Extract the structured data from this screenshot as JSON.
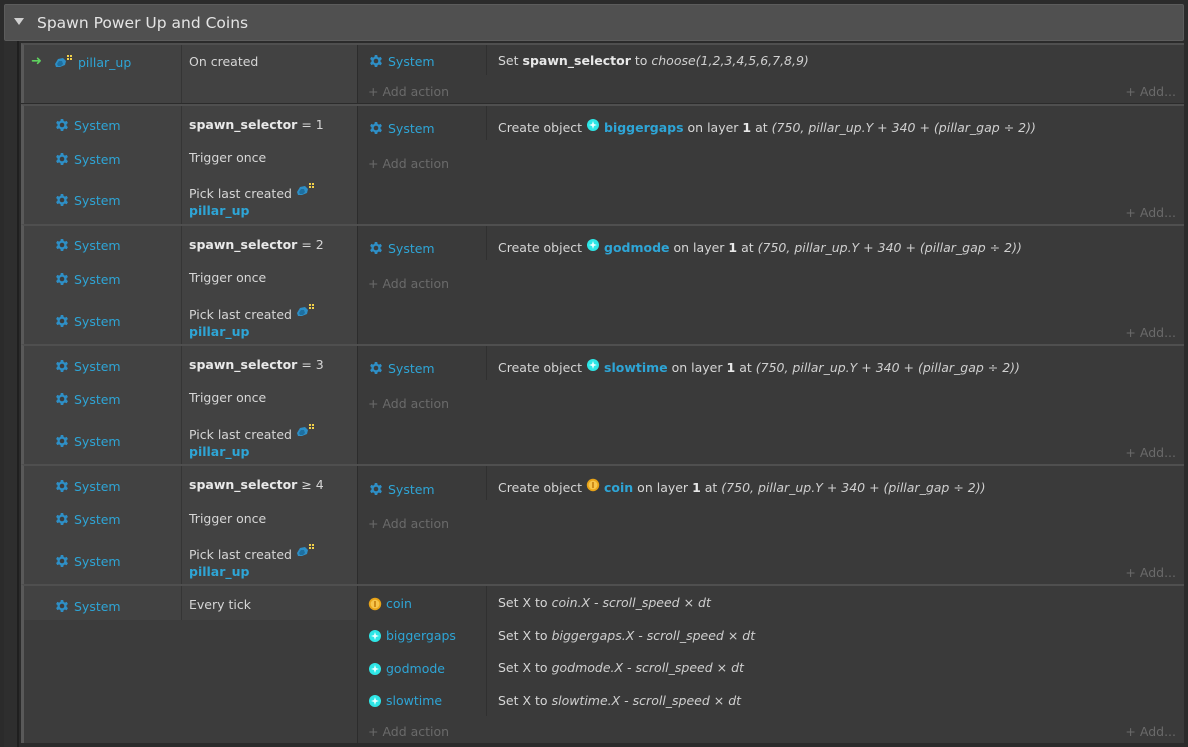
{
  "group": {
    "title": "Spawn Power Up and Coins"
  },
  "common": {
    "system": "System",
    "add_action": "+ Add action",
    "add_more": "+ Add...",
    "trigger_once": "Trigger once",
    "pick_last_created": "Pick last created",
    "pillar_up": "pillar_up",
    "create_object": "Create object",
    "on_layer": "on layer",
    "layer_num": "1",
    "at": "at",
    "expr_pos": "(750, pillar_up.Y + 340 + (pillar_gap ÷ 2))"
  },
  "event1": {
    "object": "pillar_up",
    "condition": "On created",
    "action_prefix": "Set",
    "action_var": "spawn_selector",
    "action_to": "to",
    "action_expr": "choose(1,2,3,4,5,6,7,8,9)"
  },
  "event2": {
    "var": "spawn_selector",
    "op": "= 1",
    "object": "biggergaps"
  },
  "event3": {
    "var": "spawn_selector",
    "op": "= 2",
    "object": "godmode"
  },
  "event4": {
    "var": "spawn_selector",
    "op": "= 3",
    "object": "slowtime"
  },
  "event5": {
    "var": "spawn_selector",
    "op": "≥ 4",
    "object": "coin"
  },
  "event6": {
    "condition": "Every tick",
    "actions": [
      {
        "object": "coin",
        "set": "Set X to",
        "expr": "coin.X - scroll_speed × dt"
      },
      {
        "object": "biggergaps",
        "set": "Set X to",
        "expr": "biggergaps.X - scroll_speed × dt"
      },
      {
        "object": "godmode",
        "set": "Set X to",
        "expr": "godmode.X - scroll_speed × dt"
      },
      {
        "object": "slowtime",
        "set": "Set X to",
        "expr": "slowtime.X - scroll_speed × dt"
      }
    ]
  },
  "colors": {
    "link_blue": "#2ea5d6",
    "trigger_green": "#5fd35f",
    "coin_gold": "#e8a317",
    "powerup_cyan": "#2ee6e6"
  }
}
